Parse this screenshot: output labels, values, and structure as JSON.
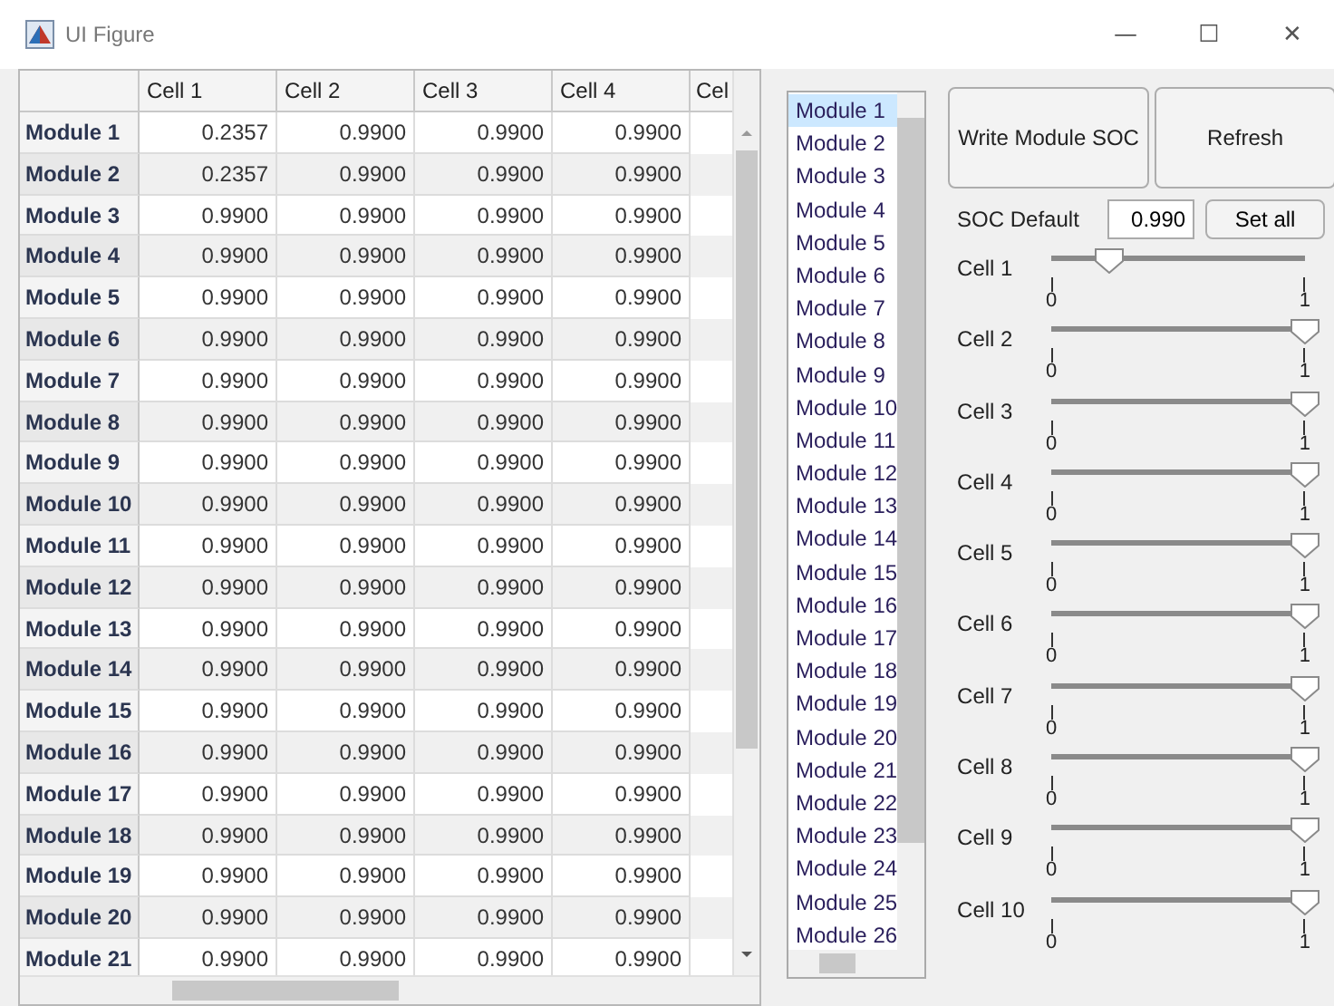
{
  "window": {
    "title": "UI Figure",
    "controls": [
      "—",
      "☐",
      "✕"
    ]
  },
  "table": {
    "columns": [
      "Cell 1",
      "Cell 2",
      "Cell 3",
      "Cell 4",
      "Cel"
    ],
    "rows": [
      {
        "name": "Module 1",
        "values": [
          "0.2357",
          "0.9900",
          "0.9900",
          "0.9900"
        ]
      },
      {
        "name": "Module 2",
        "values": [
          "0.2357",
          "0.9900",
          "0.9900",
          "0.9900"
        ]
      },
      {
        "name": "Module 3",
        "values": [
          "0.9900",
          "0.9900",
          "0.9900",
          "0.9900"
        ]
      },
      {
        "name": "Module 4",
        "values": [
          "0.9900",
          "0.9900",
          "0.9900",
          "0.9900"
        ]
      },
      {
        "name": "Module 5",
        "values": [
          "0.9900",
          "0.9900",
          "0.9900",
          "0.9900"
        ]
      },
      {
        "name": "Module 6",
        "values": [
          "0.9900",
          "0.9900",
          "0.9900",
          "0.9900"
        ]
      },
      {
        "name": "Module 7",
        "values": [
          "0.9900",
          "0.9900",
          "0.9900",
          "0.9900"
        ]
      },
      {
        "name": "Module 8",
        "values": [
          "0.9900",
          "0.9900",
          "0.9900",
          "0.9900"
        ]
      },
      {
        "name": "Module 9",
        "values": [
          "0.9900",
          "0.9900",
          "0.9900",
          "0.9900"
        ]
      },
      {
        "name": "Module 10",
        "values": [
          "0.9900",
          "0.9900",
          "0.9900",
          "0.9900"
        ]
      },
      {
        "name": "Module 11",
        "values": [
          "0.9900",
          "0.9900",
          "0.9900",
          "0.9900"
        ]
      },
      {
        "name": "Module 12",
        "values": [
          "0.9900",
          "0.9900",
          "0.9900",
          "0.9900"
        ]
      },
      {
        "name": "Module 13",
        "values": [
          "0.9900",
          "0.9900",
          "0.9900",
          "0.9900"
        ]
      },
      {
        "name": "Module 14",
        "values": [
          "0.9900",
          "0.9900",
          "0.9900",
          "0.9900"
        ]
      },
      {
        "name": "Module 15",
        "values": [
          "0.9900",
          "0.9900",
          "0.9900",
          "0.9900"
        ]
      },
      {
        "name": "Module 16",
        "values": [
          "0.9900",
          "0.9900",
          "0.9900",
          "0.9900"
        ]
      },
      {
        "name": "Module 17",
        "values": [
          "0.9900",
          "0.9900",
          "0.9900",
          "0.9900"
        ]
      },
      {
        "name": "Module 18",
        "values": [
          "0.9900",
          "0.9900",
          "0.9900",
          "0.9900"
        ]
      },
      {
        "name": "Module 19",
        "values": [
          "0.9900",
          "0.9900",
          "0.9900",
          "0.9900"
        ]
      },
      {
        "name": "Module 20",
        "values": [
          "0.9900",
          "0.9900",
          "0.9900",
          "0.9900"
        ]
      },
      {
        "name": "Module 21",
        "values": [
          "0.9900",
          "0.9900",
          "0.9900",
          "0.9900"
        ]
      }
    ]
  },
  "module_list": {
    "items": [
      {
        "label": "Module 1",
        "selected": true
      },
      {
        "label": "Module 2",
        "selected": false
      },
      {
        "label": "Module 3",
        "selected": false
      },
      {
        "label": "Module 4",
        "selected": false
      },
      {
        "label": "Module 5",
        "selected": false
      },
      {
        "label": "Module 6",
        "selected": false
      },
      {
        "label": "Module 7",
        "selected": false
      },
      {
        "label": "Module 8",
        "selected": false
      },
      {
        "label": "Module 9",
        "selected": false
      },
      {
        "label": "Module 10",
        "selected": false
      },
      {
        "label": "Module 11",
        "selected": false
      },
      {
        "label": "Module 12",
        "selected": false
      },
      {
        "label": "Module 13",
        "selected": false
      },
      {
        "label": "Module 14",
        "selected": false
      },
      {
        "label": "Module 15",
        "selected": false
      },
      {
        "label": "Module 16",
        "selected": false
      },
      {
        "label": "Module 17",
        "selected": false
      },
      {
        "label": "Module 18",
        "selected": false
      },
      {
        "label": "Module 19",
        "selected": false
      },
      {
        "label": "Module 20",
        "selected": false
      },
      {
        "label": "Module 21",
        "selected": false
      },
      {
        "label": "Module 22",
        "selected": false
      },
      {
        "label": "Module 23",
        "selected": false
      },
      {
        "label": "Module 24",
        "selected": false
      },
      {
        "label": "Module 25",
        "selected": false
      },
      {
        "label": "Module 26",
        "selected": false
      }
    ]
  },
  "buttons": [
    "Write Module SOC",
    "Refresh"
  ],
  "soc_default": {
    "label": "SOC Default",
    "value": "0.990",
    "button": "Set all"
  },
  "sliders": [
    {
      "label": "Cell 1",
      "level": 0.23,
      "min": "0",
      "max": "1"
    },
    {
      "label": "Cell 2",
      "level": 1,
      "min": "0",
      "max": "1"
    },
    {
      "label": "Cell 3",
      "level": 1,
      "min": "0",
      "max": "1"
    },
    {
      "label": "Cell 4",
      "level": 1,
      "min": "0",
      "max": "1"
    },
    {
      "label": "Cell 5",
      "level": 1,
      "min": "0",
      "max": "1"
    },
    {
      "label": "Cell 6",
      "level": 1,
      "min": "0",
      "max": "1"
    },
    {
      "label": "Cell 7",
      "level": 1,
      "min": "0",
      "max": "1"
    },
    {
      "label": "Cell 8",
      "level": 1,
      "min": "0",
      "max": "1"
    },
    {
      "label": "Cell 9",
      "level": 1,
      "min": "0",
      "max": "1"
    },
    {
      "label": "Cell 10",
      "level": 1,
      "min": "0",
      "max": "1"
    }
  ]
}
